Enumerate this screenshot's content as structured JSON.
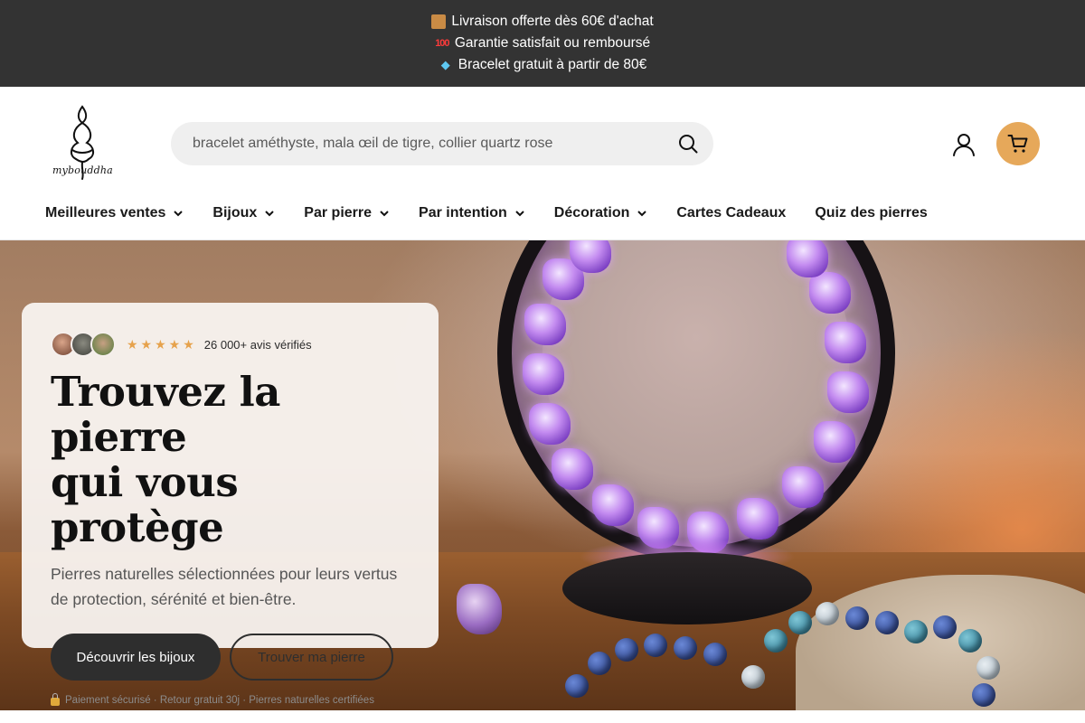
{
  "announcement": {
    "lines": [
      {
        "icon": "package-icon",
        "text": "Livraison offerte dès 60€ d'achat"
      },
      {
        "icon": "hundred-points-icon",
        "text": "Garantie satisfait ou remboursé"
      },
      {
        "icon": "gem-icon",
        "text": "Bracelet gratuit à partir de 80€"
      }
    ]
  },
  "header": {
    "logo_text": "mybouddha",
    "search_placeholder": "bracelet améthyste, mala œil de tigre, collier quartz rose",
    "nav": [
      {
        "label": "Meilleures ventes",
        "dropdown": true
      },
      {
        "label": "Bijoux",
        "dropdown": true
      },
      {
        "label": "Par pierre",
        "dropdown": true
      },
      {
        "label": "Par intention",
        "dropdown": true
      },
      {
        "label": "Décoration",
        "dropdown": true
      },
      {
        "label": "Cartes Cadeaux",
        "dropdown": false
      },
      {
        "label": "Quiz des pierres",
        "dropdown": false
      }
    ]
  },
  "hero": {
    "rating_stars": 5,
    "reviews_text": "26 000+ avis vérifiés",
    "title_line1": "Trouvez la pierre",
    "title_line2": "qui vous protège",
    "subtitle": "Pierres naturelles sélectionnées pour leurs vertus de protection, sérénité et bien-être.",
    "primary_cta": "Découvrir les bijoux",
    "secondary_cta": "Trouver ma pierre",
    "trust_text": "Paiement sécurisé · Retour gratuit 30j · Pierres naturelles certifiées"
  },
  "colors": {
    "announcement_bg": "#333333",
    "accent": "#e6a85a",
    "primary_button": "#2e2e2e",
    "star": "#e6a24c"
  }
}
